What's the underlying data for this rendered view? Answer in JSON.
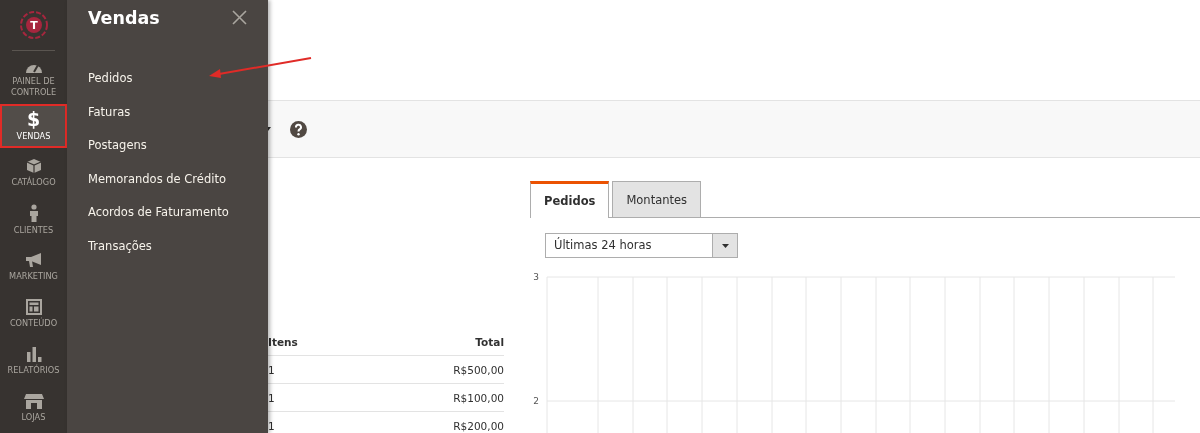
{
  "logo": {
    "letter": "T"
  },
  "nav": [
    {
      "label": "PAINEL DE CONTROLE",
      "kind": "gauge",
      "selected": false,
      "highlighted": false
    },
    {
      "label": "VENDAS",
      "kind": "dollar",
      "glyph": "$",
      "selected": true,
      "highlighted": true
    },
    {
      "label": "CATÁLOGO",
      "kind": "box",
      "selected": false,
      "highlighted": false
    },
    {
      "label": "CLIENTES",
      "kind": "person",
      "selected": false,
      "highlighted": false
    },
    {
      "label": "MARKETING",
      "kind": "megaphone",
      "selected": false,
      "highlighted": false
    },
    {
      "label": "CONTEÚDO",
      "kind": "layout",
      "selected": false,
      "highlighted": false
    },
    {
      "label": "RELATÓRIOS",
      "kind": "bars",
      "selected": false,
      "highlighted": false
    },
    {
      "label": "LOJAS",
      "kind": "store",
      "selected": false,
      "highlighted": false
    }
  ],
  "flyout": {
    "title": "Vendas",
    "items": [
      "Pedidos",
      "Faturas",
      "Postagens",
      "Memorandos de Crédito",
      "Acordos de Faturamento",
      "Transações"
    ]
  },
  "table": {
    "columns": [
      "Itens",
      "Total"
    ],
    "rows": [
      [
        "1",
        "R$500,00"
      ],
      [
        "1",
        "R$100,00"
      ],
      [
        "1",
        "R$200,00"
      ]
    ]
  },
  "tabs": [
    {
      "label": "Pedidos",
      "selected": true
    },
    {
      "label": "Montantes",
      "selected": false
    }
  ],
  "period_select": {
    "value": "Últimas 24 horas"
  },
  "chart": {
    "axis_labels": [
      "3",
      "2"
    ]
  }
}
